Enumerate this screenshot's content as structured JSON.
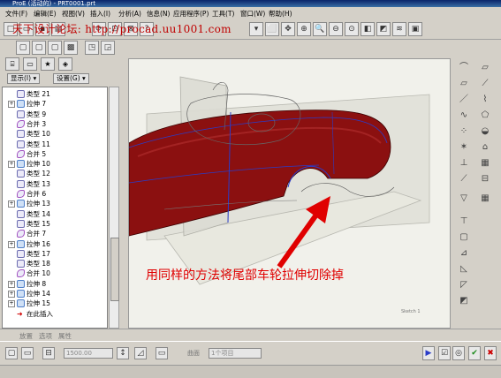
{
  "window": {
    "title": "ProE (活动的) - PRT0001.prt"
  },
  "menu": {
    "items": [
      "文件(F)",
      "编辑(E)",
      "视图(V)",
      "插入(I)",
      "分析(A)",
      "信息(N)",
      "应用程序(P)",
      "工具(T)",
      "窗口(W)",
      "帮助(H)"
    ]
  },
  "watermark": {
    "text": "天下设计论坛: http://procad.uu1001.com"
  },
  "left_panel": {
    "show_label": "显示(I) ▾",
    "settings_label": "设置(G) ▾"
  },
  "tree": {
    "items": [
      {
        "label": "类型 21",
        "type": "feature",
        "expander": false
      },
      {
        "label": "拉伸 7",
        "type": "extrude",
        "expander": true
      },
      {
        "label": "类型 9",
        "type": "feature",
        "expander": false
      },
      {
        "label": "合并 3",
        "type": "merge",
        "expander": false
      },
      {
        "label": "类型 10",
        "type": "feature",
        "expander": false
      },
      {
        "label": "类型 11",
        "type": "feature",
        "expander": false
      },
      {
        "label": "合并 5",
        "type": "merge",
        "expander": false
      },
      {
        "label": "拉伸 10",
        "type": "extrude",
        "expander": true
      },
      {
        "label": "类型 12",
        "type": "feature",
        "expander": false
      },
      {
        "label": "类型 13",
        "type": "feature",
        "expander": false
      },
      {
        "label": "合并 6",
        "type": "merge",
        "expander": false
      },
      {
        "label": "拉伸 13",
        "type": "extrude",
        "expander": true
      },
      {
        "label": "类型 14",
        "type": "feature",
        "expander": false
      },
      {
        "label": "类型 15",
        "type": "feature",
        "expander": false
      },
      {
        "label": "合并 7",
        "type": "merge",
        "expander": false
      },
      {
        "label": "拉伸 16",
        "type": "extrude",
        "expander": true
      },
      {
        "label": "类型 17",
        "type": "feature",
        "expander": false
      },
      {
        "label": "类型 18",
        "type": "feature",
        "expander": false
      },
      {
        "label": "合并 10",
        "type": "merge",
        "expander": false
      },
      {
        "label": "拉伸 8",
        "type": "extrude",
        "expander": true
      },
      {
        "label": "拉伸 14",
        "type": "extrude",
        "expander": true
      },
      {
        "label": "拉伸 15",
        "type": "extrude",
        "expander": true
      },
      {
        "label": "在此插入",
        "type": "insert",
        "expander": false
      }
    ]
  },
  "annotation": {
    "text": "用同样的方法将尾部车轮拉伸切除掉"
  },
  "viewport": {
    "corner_label": "Sketch 1"
  },
  "status_bar": {
    "items": [
      "放置",
      "选项",
      "属性"
    ]
  },
  "dashboard": {
    "depth_value": "1500.00",
    "plane_label": "曲面",
    "item_field": "1个项目"
  },
  "colors": {
    "car_body": "#8b1010",
    "annotation": "#e00000",
    "watermark": "#c00000",
    "accent_blue": "#2a3cc8"
  }
}
